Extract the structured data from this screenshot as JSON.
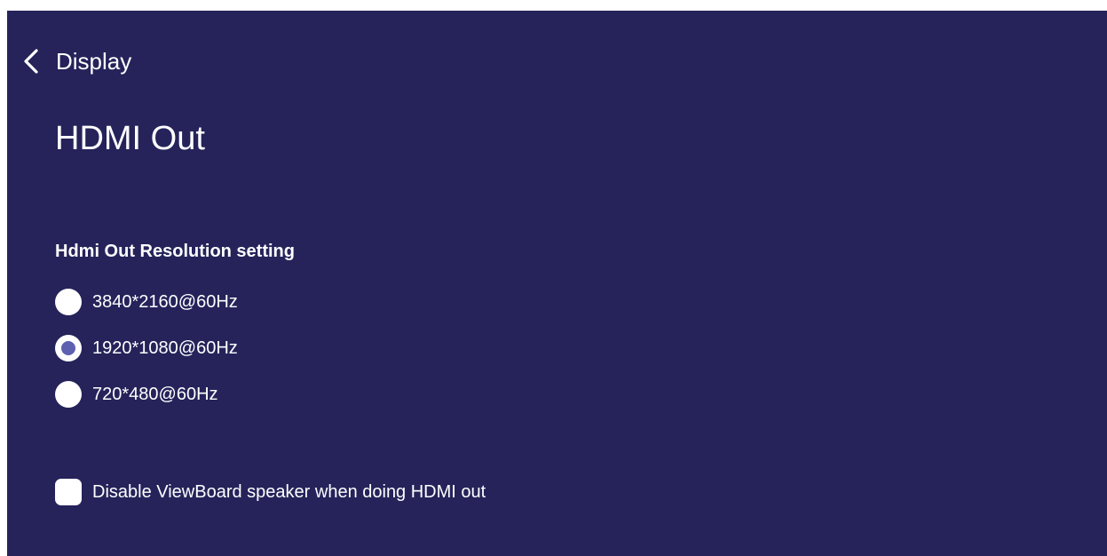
{
  "header": {
    "back_label": "Display",
    "back_icon": "chevron-left-icon"
  },
  "page": {
    "title": "HDMI Out"
  },
  "resolution": {
    "section_title": "Hdmi Out Resolution setting",
    "options": [
      {
        "label": "3840*2160@60Hz",
        "selected": false
      },
      {
        "label": "1920*1080@60Hz",
        "selected": true
      },
      {
        "label": "720*480@60Hz",
        "selected": false
      }
    ]
  },
  "speaker": {
    "label": "Disable ViewBoard speaker when doing HDMI out",
    "checked": false
  },
  "colors": {
    "background": "#25235a",
    "accent": "#5e60b0",
    "text": "#ffffff"
  }
}
